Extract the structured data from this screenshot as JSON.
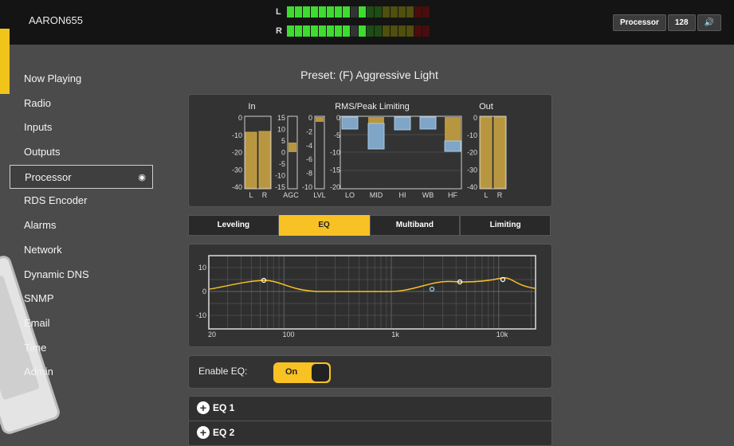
{
  "device": "AARON655",
  "meters": {
    "left": {
      "label": "L"
    },
    "right": {
      "label": "R"
    },
    "segments": [
      "#3ddc2e",
      "#3ddc2e",
      "#3ddc2e",
      "#3ddc2e",
      "#3ddc2e",
      "#3ddc2e",
      "#3ddc2e",
      "#3ddc2e",
      "#333",
      "#3ddc2e",
      "#1d4d14",
      "#1d4d14",
      "#4f4f0e",
      "#4f4f0e",
      "#4f4f0e",
      "#4f4f0e",
      "#4a0c0c",
      "#4a0c0c"
    ]
  },
  "status": {
    "mode": "Processor",
    "bitrate": "128",
    "audio_icon": "speaker-icon"
  },
  "sidebar": {
    "items": [
      {
        "label": "Now Playing"
      },
      {
        "label": "Radio"
      },
      {
        "label": "Inputs"
      },
      {
        "label": "Outputs"
      },
      {
        "label": "Processor",
        "active": true
      },
      {
        "label": "RDS Encoder"
      },
      {
        "label": "Alarms"
      },
      {
        "label": "Network"
      },
      {
        "label": "Dynamic DNS"
      },
      {
        "label": "SNMP"
      },
      {
        "label": "Email"
      },
      {
        "label": "Time"
      },
      {
        "label": "Admin"
      }
    ]
  },
  "preset": "Preset: (F) Aggressive Light",
  "level_meters": {
    "in_title": "In",
    "rms_title": "RMS/Peak Limiting",
    "out_title": "Out",
    "in_ticks": [
      "0",
      "-10",
      "-20",
      "-30",
      "-40"
    ],
    "in_labels": [
      "L",
      "R"
    ],
    "agc_ticks": [
      "15",
      "10",
      "5",
      "0",
      "-5",
      "-10",
      "-15"
    ],
    "agc_label": "AGC",
    "lvl_ticks": [
      "0",
      "-2",
      "-4",
      "-6",
      "-8",
      "-10"
    ],
    "lvl_label": "LVL",
    "rms_ticks": [
      "0",
      "-5",
      "-10",
      "-15",
      "-20"
    ],
    "band_labels": [
      "LO",
      "MID",
      "HI",
      "WB",
      "HF"
    ],
    "out_ticks": [
      "0",
      "-10",
      "-20",
      "-30",
      "-40"
    ],
    "out_labels": [
      "L",
      "R"
    ]
  },
  "tabs": [
    "Leveling",
    "EQ",
    "Multiband",
    "Limiting"
  ],
  "active_tab": "EQ",
  "eq_chart": {
    "y_ticks": [
      "10",
      "0",
      "-10"
    ],
    "x_ticks": [
      "20",
      "100",
      "1k",
      "10k"
    ]
  },
  "enable_eq": {
    "label": "Enable EQ:",
    "value": "On"
  },
  "accordions": [
    {
      "label": "EQ 1"
    },
    {
      "label": "EQ 2"
    }
  ],
  "colors": {
    "accent": "#f8c124",
    "meter_green": "#3ddc2e",
    "bar_gold": "#b8963f",
    "bar_blue": "#7fa6c7"
  }
}
